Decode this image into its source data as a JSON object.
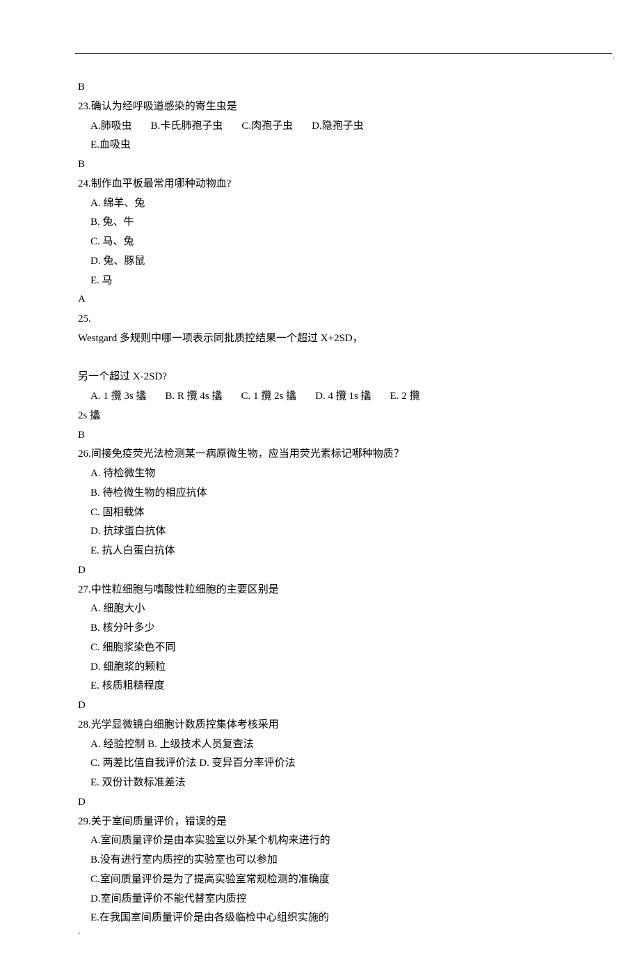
{
  "topRightDot": ".",
  "bottomLeftDot": ".",
  "lines": [
    {
      "text": "B"
    },
    {
      "text": "23.确认为经呼吸道感染的寄生虫是"
    },
    {
      "indent": true,
      "inlineOptions": [
        "A.肺吸虫",
        "B.卡氏肺孢子虫",
        "C.肉孢子虫",
        "D.隐孢子虫"
      ]
    },
    {
      "indent": true,
      "text": "E.血吸虫"
    },
    {
      "text": "B"
    },
    {
      "text": "24.制作血平板最常用哪种动物血?"
    },
    {
      "indent": true,
      "text": "A.  绵羊、兔"
    },
    {
      "indent": true,
      "text": "B.  兔、牛"
    },
    {
      "indent": true,
      "text": "C.  马、兔"
    },
    {
      "indent": true,
      "text": "D.  兔、豚鼠"
    },
    {
      "indent": true,
      "text": "E.  马"
    },
    {
      "text": "A"
    },
    {
      "text": "25."
    },
    {
      "text": "Westgard 多规则中哪一项表示同批质控结果一个超过 X+2SD，"
    },
    {
      "text": "　"
    },
    {
      "text": " 另一个超过 X-2SD?"
    },
    {
      "indent": true,
      "inlineOptions": [
        "A. 1 攬 3s 攭",
        "B. R 攬 4s 攭",
        "C. 1 攬 2s 攭",
        "D. 4 攬 1s 攭",
        "E. 2 攬"
      ]
    },
    {
      "text": "2s 攭"
    },
    {
      "text": "B"
    },
    {
      "text": "26.间接免疫荧光法检测某一病原微生物，应当用荧光素标记哪种物质？"
    },
    {
      "indent": true,
      "text": "A.  待检微生物"
    },
    {
      "indent": true,
      "text": "B.  待检微生物的相应抗体"
    },
    {
      "indent": true,
      "text": "C.  固相载体"
    },
    {
      "indent": true,
      "text": "D.  抗球蛋白抗体"
    },
    {
      "indent": true,
      "text": "E.  抗人白蛋白抗体"
    },
    {
      "text": "D"
    },
    {
      "text": "27.中性粒细胞与嗜酸性粒细胞的主要区别是"
    },
    {
      "indent": true,
      "text": "A.  细胞大小"
    },
    {
      "indent": true,
      "text": "B.  核分叶多少"
    },
    {
      "indent": true,
      "text": "C.  细胞浆染色不同"
    },
    {
      "indent": true,
      "text": "D.  细胞浆的颗粒"
    },
    {
      "indent": true,
      "text": "E.  核质粗糙程度"
    },
    {
      "text": "D"
    },
    {
      "text": "28.光学显微镜白细胞计数质控集体考核采用"
    },
    {
      "indent": true,
      "text": "A.  经验控制 B.  上级技术人员复查法"
    },
    {
      "indent": true,
      "text": "C.  两差比值自我评价法 D.  变异百分率评价法"
    },
    {
      "indent": true,
      "text": "E.  双份计数标准差法"
    },
    {
      "text": "D"
    },
    {
      "text": "29.关于室间质量评价，错误的是"
    },
    {
      "indent": true,
      "text": "A.室间质量评价是由本实验室以外某个机构来进行的"
    },
    {
      "indent": true,
      "text": "B.没有进行室内质控的实验室也可以参加"
    },
    {
      "indent": true,
      "text": "C.室间质量评价是为了提高实验室常规检测的准确度"
    },
    {
      "indent": true,
      "text": "D.室间质量评价不能代替室内质控"
    },
    {
      "indent": true,
      "text": "E.在我国室间质量评价是由各级临检中心组织实施的"
    }
  ]
}
